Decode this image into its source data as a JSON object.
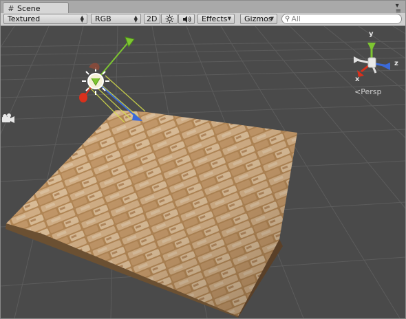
{
  "window": {
    "tab_label": "Scene",
    "tab_icon": "grid-icon",
    "menu_icon": "tab-menu-icon"
  },
  "toolbar": {
    "render_mode": "Textured",
    "color_mode": "RGB",
    "mode_2d": "2D",
    "lighting_icon": "sun-icon",
    "audio_icon": "speaker-icon",
    "effects_label": "Effects",
    "gizmos_label": "Gizmos",
    "search_placeholder": "All",
    "search_icon": "search-icon"
  },
  "scene": {
    "orientation_gizmo": {
      "axis_y": "y",
      "axis_z": "z",
      "axis_x": "x",
      "projection_label": "Persp"
    },
    "colors": {
      "background": "#4a4a4a",
      "grid": "#5a5a5a",
      "axis_x": "#d9301c",
      "axis_y": "#7dc531",
      "axis_z": "#3b6ad9"
    }
  }
}
